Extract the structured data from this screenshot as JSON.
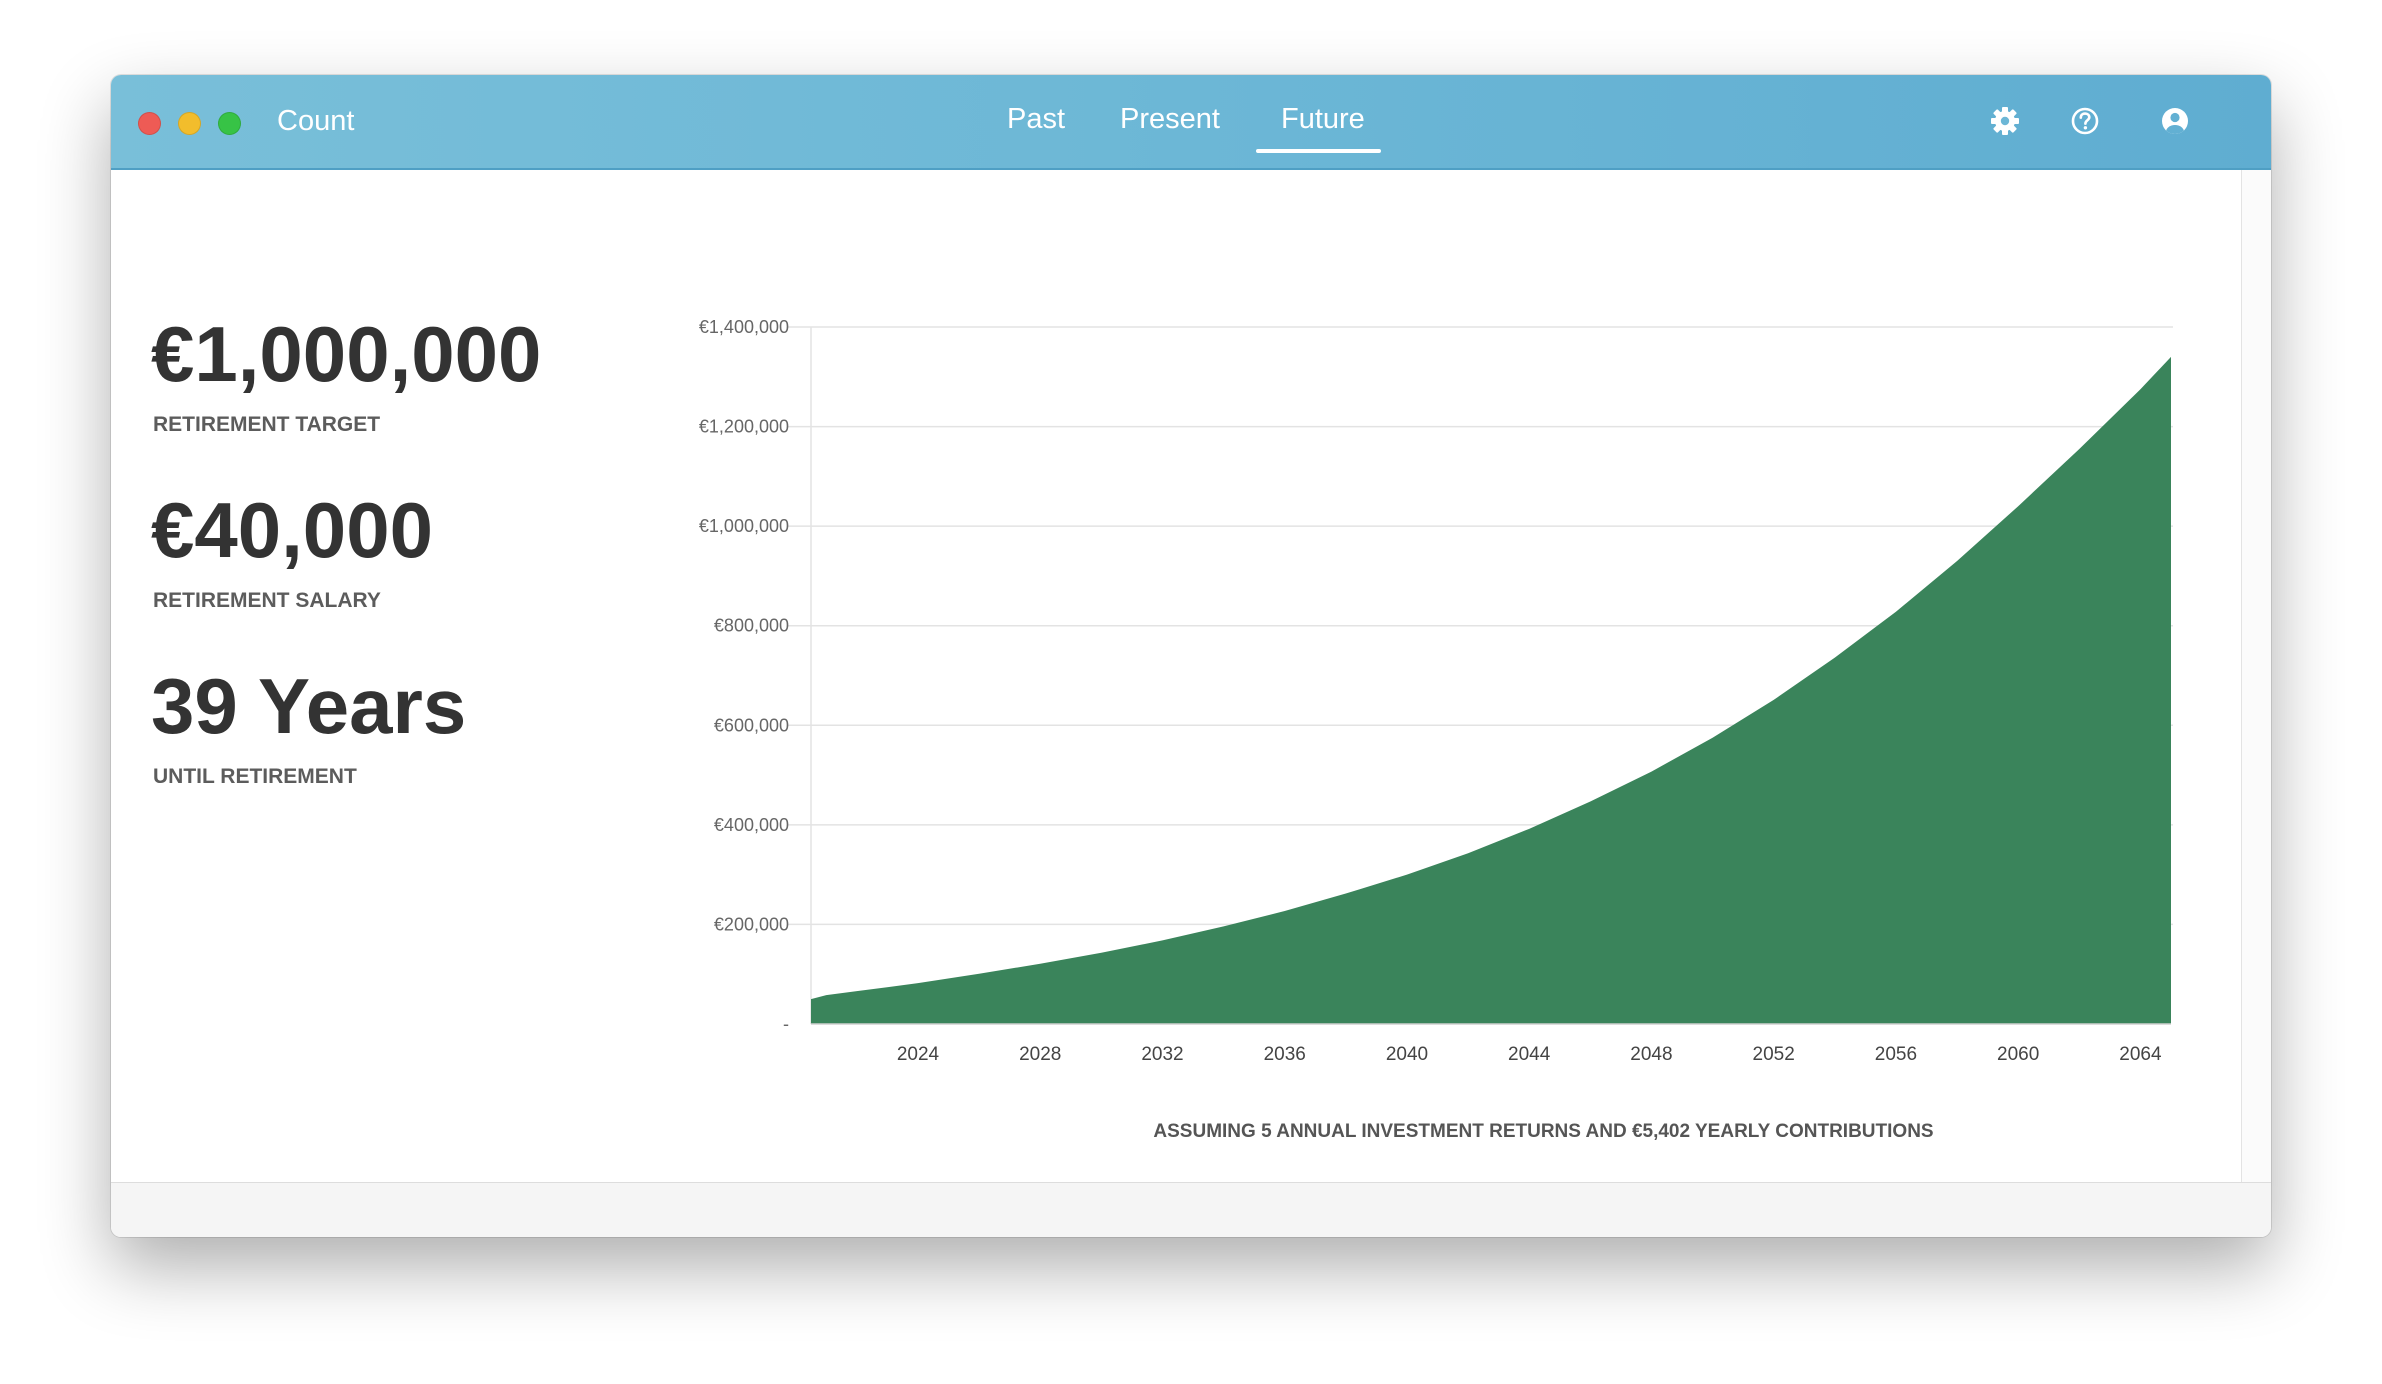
{
  "window": {
    "app_title": "Count",
    "nav": {
      "past": "Past",
      "present": "Present",
      "future": "Future",
      "active": "Future"
    },
    "icons": [
      "gear-icon",
      "help-icon",
      "user-icon"
    ]
  },
  "stats": [
    {
      "value": "€1,000,000",
      "label": "RETIREMENT TARGET"
    },
    {
      "value": "€40,000",
      "label": "RETIREMENT SALARY"
    },
    {
      "value": "39 Years",
      "label": "UNTIL RETIREMENT"
    }
  ],
  "caption": "ASSUMING 5 ANNUAL INVESTMENT RETURNS AND €5,402 YEARLY CONTRIBUTIONS",
  "colors": {
    "titlebar": "#6cb7d6",
    "area_fill": "#3a845b",
    "grid": "#e3e3e3"
  },
  "chart_data": {
    "type": "area",
    "x_label_format": "year",
    "xlim": [
      2020.5,
      2065
    ],
    "ylim": [
      0,
      1400000
    ],
    "y_ticks": [
      {
        "value": 0,
        "label": "-"
      },
      {
        "value": 200000,
        "label": "€200,000"
      },
      {
        "value": 400000,
        "label": "€400,000"
      },
      {
        "value": 600000,
        "label": "€600,000"
      },
      {
        "value": 800000,
        "label": "€800,000"
      },
      {
        "value": 1000000,
        "label": "€1,000,000"
      },
      {
        "value": 1200000,
        "label": "€1,200,000"
      },
      {
        "value": 1400000,
        "label": "€1,400,000"
      }
    ],
    "x_ticks": [
      {
        "value": 2024,
        "label": "2024"
      },
      {
        "value": 2028,
        "label": "2028"
      },
      {
        "value": 2032,
        "label": "2032"
      },
      {
        "value": 2036,
        "label": "2036"
      },
      {
        "value": 2040,
        "label": "2040"
      },
      {
        "value": 2044,
        "label": "2044"
      },
      {
        "value": 2048,
        "label": "2048"
      },
      {
        "value": 2052,
        "label": "2052"
      },
      {
        "value": 2056,
        "label": "2056"
      },
      {
        "value": 2060,
        "label": "2060"
      },
      {
        "value": 2064,
        "label": "2064"
      }
    ],
    "grid": true,
    "series": [
      {
        "x": [
          2020.5,
          2021,
          2022,
          2024,
          2026,
          2028,
          2030,
          2032,
          2034,
          2036,
          2038,
          2040,
          2042,
          2044,
          2046,
          2048,
          2050,
          2052,
          2054,
          2056,
          2058,
          2060,
          2062,
          2064,
          2065
        ],
        "values": [
          50000,
          58000,
          66000,
          82000,
          101000,
          121000,
          143000,
          168000,
          196000,
          227000,
          262000,
          300000,
          343000,
          392000,
          447000,
          507000,
          575000,
          651000,
          736000,
          828000,
          930000,
          1040000,
          1155000,
          1275000,
          1340000
        ]
      }
    ]
  }
}
